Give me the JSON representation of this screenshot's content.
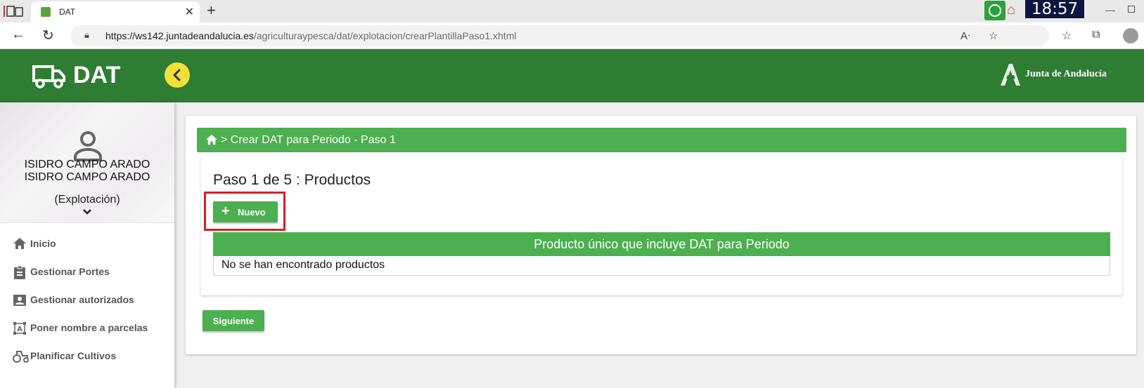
{
  "browser": {
    "tab_title": "DAT",
    "url_host": "https://ws142.juntadeandalucia.es",
    "url_path": "/agriculturaypesca/dat/explotacion/crearPlantillaPaso1.xhtml",
    "clock": "18:57"
  },
  "header": {
    "app_title": "DAT",
    "brand": "Junta de Andalucía",
    "color": "#2e7d32"
  },
  "profile": {
    "name_line1": "ISIDRO CAMPO ARADO",
    "name_line2": "ISIDRO CAMPO ARADO",
    "role": "(Explotación)"
  },
  "sidebar": {
    "items": [
      {
        "label": "Inicio",
        "icon": "home-icon"
      },
      {
        "label": "Gestionar Portes",
        "icon": "clipboard-icon"
      },
      {
        "label": "Gestionar autorizados",
        "icon": "contact-card-icon"
      },
      {
        "label": "Poner nombre a parcelas",
        "icon": "text-box-icon"
      },
      {
        "label": "Planificar Cultivos",
        "icon": "tractor-icon"
      }
    ]
  },
  "main": {
    "breadcrumb": "> Crear DAT para Periodo - Paso 1",
    "step_title": "Paso 1 de 5 : Productos",
    "new_button": "Nuevo",
    "table_header": "Producto único que incluye DAT para Periodo",
    "empty_message": "No se han encontrado productos",
    "next_button": "Siguiente",
    "accent": "#4caf50",
    "highlight_color": "#d32027"
  }
}
